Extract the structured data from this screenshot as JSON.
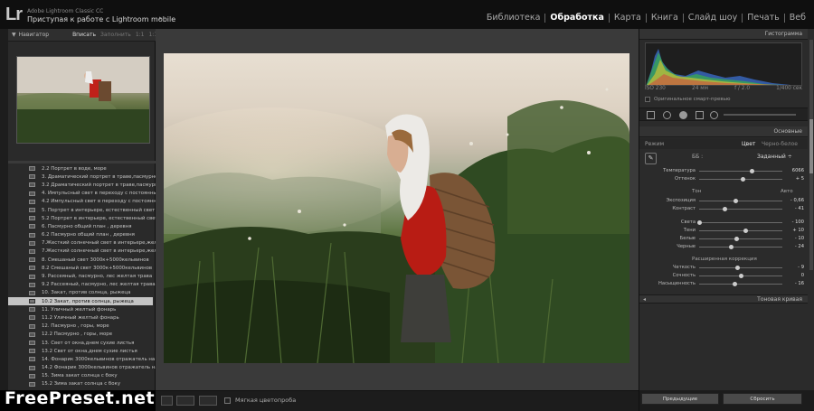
{
  "app": {
    "logo": "Lr",
    "product": "Adobe Lightroom Classic CC",
    "title": "Приступая к работе с Lightroom mobile"
  },
  "modules": [
    {
      "label": "Библиотека",
      "active": false
    },
    {
      "label": "Обработка",
      "active": true
    },
    {
      "label": "Карта",
      "active": false
    },
    {
      "label": "Книга",
      "active": false
    },
    {
      "label": "Слайд шоу",
      "active": false
    },
    {
      "label": "Печать",
      "active": false
    },
    {
      "label": "Веб",
      "active": false
    }
  ],
  "navigator": {
    "title": "Навигатор",
    "options": [
      "Вписать",
      "Заполнить",
      "1:1",
      "1:1"
    ]
  },
  "presets": [
    "2.2 Портрет в воде, море",
    "3. Драматический портрет в траве,пасмурно",
    "3.2 Драматический портрет в траве,пасмурно",
    "4. Импульсный свет в переходу с постоянным",
    "4.2 Импульсный свет в переходу с постоянным",
    "5. Портрет в интерьере, естественный свет",
    "5.2 Портрет в интерьере, естественный свет",
    "6. Пасмурно общий план , деревня",
    "6.2 Пасмурно общий план , деревня",
    "7.Жесткий солнечный свет в интерьере,желтые",
    "7.Жесткий солнечный свет в интерьере,желтые",
    "8. Смешаный свет 3000к+5000кельвинов",
    "8.2 Смешаный свет 3000к+5000кельвинов",
    "9. Рассеяный, пасмурно, лес желтая трава",
    "9.2 Рассеяный, пасмурно, лес желтая трава",
    "10. Закат, против солнца, рыжеца",
    "10.2 Закат, против солнца, рыжеца",
    "11. Уличный желтый фонарь",
    "11.2 Уличный желтый фонарь",
    "12. Пасмурно , горы, море",
    "12.2 Пасмурно , горы, море",
    "13. Свет от окна,днем сухие листья",
    "13.2 Свет от окна,днем сухие листья",
    "14. Фонарик 3000кельвинов отражатель на лицо",
    "14.2 Фонарик 3000кельвинов отражатель на лицо",
    "15. Зима закат солнца с боку",
    "15.2 Зима закат солнца с боку"
  ],
  "selected_preset_index": 16,
  "toolbar": {
    "soft_proof_label": "Мягкая цветопроба"
  },
  "watermark": "FreePreset.net",
  "right": {
    "histogram_header": "Гистограмма",
    "camera": {
      "iso": "ISO 230",
      "focal": "24 мм",
      "aperture": "f / 2.0",
      "shutter": "1/400 сек"
    },
    "original_photo": "Оригинальное смарт-превью",
    "basic_header": "Основные",
    "mode_label": "Режим",
    "mode_color": "Цвет",
    "mode_bw": "Черно-белое",
    "wb_label": "ББ :",
    "wb_value": "Заданный ÷",
    "tone_label": "Тон",
    "tone_auto": "Авто",
    "presence_label": "Расширенная коррекция",
    "tone_curve_header": "Тоновая кривая",
    "previous_button": "Предыдущие",
    "reset_button": "Сбросить"
  },
  "sliders": [
    {
      "label": "Температура",
      "value": "6066",
      "pos": 0.63
    },
    {
      "label": "Оттенок",
      "value": "+ 5",
      "pos": 0.52
    },
    {
      "label": "Экспозиция",
      "value": "- 0,66",
      "pos": 0.44
    },
    {
      "label": "Контраст",
      "value": "- 41",
      "pos": 0.3
    },
    {
      "label": "Света",
      "value": "- 100",
      "pos": 0.0
    },
    {
      "label": "Тени",
      "value": "+ 10",
      "pos": 0.55
    },
    {
      "label": "Белые",
      "value": "- 10",
      "pos": 0.45
    },
    {
      "label": "Черные",
      "value": "- 24",
      "pos": 0.38
    },
    {
      "label": "Четкость",
      "value": "- 9",
      "pos": 0.46
    },
    {
      "label": "Сочность",
      "value": "0",
      "pos": 0.5
    },
    {
      "label": "Насыщенность",
      "value": "- 16",
      "pos": 0.42
    }
  ],
  "colors": {
    "accent": "#ffffff",
    "panel": "#2b2b2b",
    "selected_row": "#c4c4c4"
  }
}
